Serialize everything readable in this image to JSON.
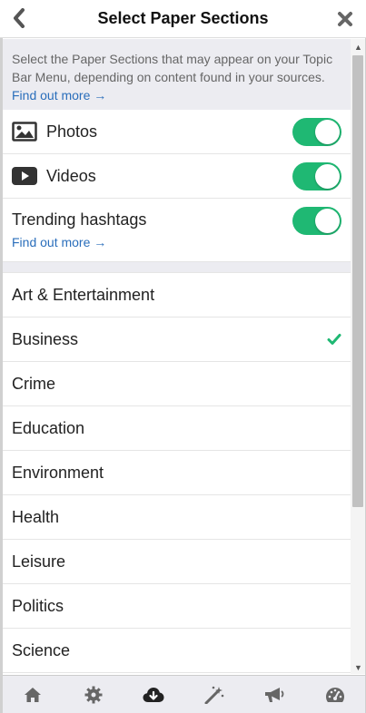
{
  "header": {
    "title": "Select Paper Sections"
  },
  "intro": {
    "text": "Select the Paper Sections that may appear on your Topic Bar Menu, depending on content found in your sources.",
    "link": "Find out more →"
  },
  "toggles": [
    {
      "label": "Photos",
      "icon": "image-icon",
      "on": true
    },
    {
      "label": "Videos",
      "icon": "play-icon",
      "on": true
    }
  ],
  "trending": {
    "label": "Trending hashtags",
    "link": "Find out more →",
    "on": true
  },
  "sections": [
    {
      "label": "Art & Entertainment",
      "checked": false
    },
    {
      "label": "Business",
      "checked": true
    },
    {
      "label": "Crime",
      "checked": false
    },
    {
      "label": "Education",
      "checked": false
    },
    {
      "label": "Environment",
      "checked": false
    },
    {
      "label": "Health",
      "checked": false
    },
    {
      "label": "Leisure",
      "checked": false
    },
    {
      "label": "Politics",
      "checked": false
    },
    {
      "label": "Science",
      "checked": false
    }
  ],
  "bottom_nav": [
    "home-icon",
    "gear-icon",
    "cloud-download-icon",
    "magic-wand-icon",
    "megaphone-icon",
    "dashboard-icon"
  ],
  "colors": {
    "toggle_on": "#1fb873",
    "check": "#1fb873",
    "link": "#2a6ebb",
    "intro_bg": "#ececf1"
  }
}
